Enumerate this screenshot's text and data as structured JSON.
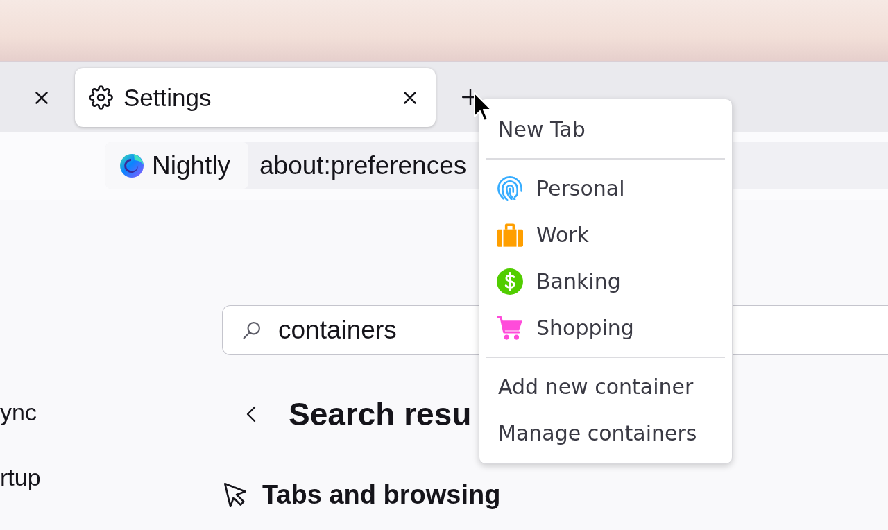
{
  "tabs": [
    {
      "selected": false
    },
    {
      "title": "Settings",
      "selected": true
    }
  ],
  "url_bar": {
    "identity": "Nightly",
    "url": "about:preferences"
  },
  "sidebar": {
    "items": [
      {
        "label": "ync"
      },
      {
        "label": "rtup"
      }
    ]
  },
  "search": {
    "value": "containers"
  },
  "page_heading": "Search resu",
  "section": {
    "title": "Tabs and browsing"
  },
  "new_tab_menu": {
    "items": [
      {
        "kind": "action",
        "label": "New Tab"
      },
      {
        "kind": "separator"
      },
      {
        "kind": "container",
        "label": "Personal",
        "color": "#37adff"
      },
      {
        "kind": "container",
        "label": "Work",
        "color": "#ff9f00"
      },
      {
        "kind": "container",
        "label": "Banking",
        "color": "#51cd00"
      },
      {
        "kind": "container",
        "label": "Shopping",
        "color": "#ff4bda"
      },
      {
        "kind": "separator"
      },
      {
        "kind": "action",
        "label": "Add new container"
      },
      {
        "kind": "action",
        "label": "Manage containers"
      }
    ]
  }
}
